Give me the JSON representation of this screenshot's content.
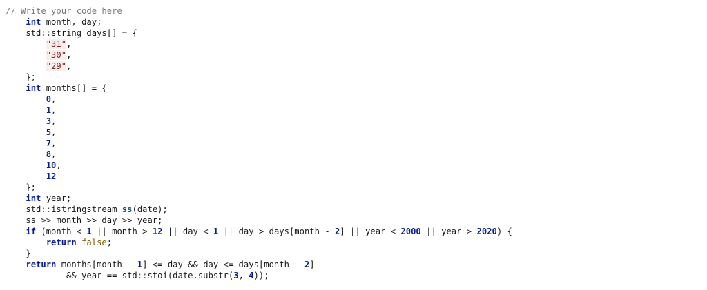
{
  "editor": {
    "lines": [
      [
        [
          "comment",
          "// Write your code here"
        ]
      ],
      [
        [
          "plain",
          "    "
        ],
        [
          "kw",
          "int"
        ],
        [
          "plain",
          " month, day;"
        ]
      ],
      [
        [
          "plain",
          "    std"
        ],
        [
          "op",
          "::"
        ],
        [
          "plain",
          "string days[] = {"
        ]
      ],
      [
        [
          "plain",
          "        "
        ],
        [
          "str",
          "\"31\""
        ],
        [
          "plain",
          ","
        ]
      ],
      [
        [
          "plain",
          "        "
        ],
        [
          "str",
          "\"30\""
        ],
        [
          "plain",
          ","
        ]
      ],
      [
        [
          "plain",
          "        "
        ],
        [
          "str",
          "\"29\""
        ],
        [
          "plain",
          ","
        ]
      ],
      [
        [
          "plain",
          "    };"
        ]
      ],
      [
        [
          "plain",
          "    "
        ],
        [
          "kw",
          "int"
        ],
        [
          "plain",
          " months[] = {"
        ]
      ],
      [
        [
          "plain",
          "        "
        ],
        [
          "num",
          "0"
        ],
        [
          "plain",
          ","
        ]
      ],
      [
        [
          "plain",
          "        "
        ],
        [
          "num",
          "1"
        ],
        [
          "plain",
          ","
        ]
      ],
      [
        [
          "plain",
          "        "
        ],
        [
          "num",
          "3"
        ],
        [
          "plain",
          ","
        ]
      ],
      [
        [
          "plain",
          "        "
        ],
        [
          "num",
          "5"
        ],
        [
          "plain",
          ","
        ]
      ],
      [
        [
          "plain",
          "        "
        ],
        [
          "num",
          "7"
        ],
        [
          "plain",
          ","
        ]
      ],
      [
        [
          "plain",
          "        "
        ],
        [
          "num",
          "8"
        ],
        [
          "plain",
          ","
        ]
      ],
      [
        [
          "plain",
          "        "
        ],
        [
          "num",
          "10"
        ],
        [
          "plain",
          ","
        ]
      ],
      [
        [
          "plain",
          "        "
        ],
        [
          "num",
          "12"
        ]
      ],
      [
        [
          "plain",
          "    };"
        ]
      ],
      [
        [
          "plain",
          "    "
        ],
        [
          "kw",
          "int"
        ],
        [
          "plain",
          " year;"
        ]
      ],
      [
        [
          "plain",
          "    std"
        ],
        [
          "op",
          "::"
        ],
        [
          "plain",
          "istringstream "
        ],
        [
          "fn",
          "ss"
        ],
        [
          "plain",
          "(date);"
        ]
      ],
      [
        [
          "plain",
          "    ss >> month >> day >> year;"
        ]
      ],
      [
        [
          "plain",
          "    "
        ],
        [
          "kw",
          "if"
        ],
        [
          "plain",
          " (month < "
        ],
        [
          "num",
          "1"
        ],
        [
          "plain",
          " || month > "
        ],
        [
          "num",
          "12"
        ],
        [
          "plain",
          " || day < "
        ],
        [
          "num",
          "1"
        ],
        [
          "plain",
          " || day > days[month - "
        ],
        [
          "num",
          "2"
        ],
        [
          "plain",
          "] || year < "
        ],
        [
          "num",
          "2000"
        ],
        [
          "plain",
          " || year > "
        ],
        [
          "num",
          "2020"
        ],
        [
          "plain",
          ") {"
        ]
      ],
      [
        [
          "plain",
          "        "
        ],
        [
          "kw",
          "return"
        ],
        [
          "plain",
          " "
        ],
        [
          "bool",
          "false"
        ],
        [
          "plain",
          ";"
        ]
      ],
      [
        [
          "plain",
          "    }"
        ]
      ],
      [
        [
          "plain",
          "    "
        ],
        [
          "kw",
          "return"
        ],
        [
          "plain",
          " months[month - "
        ],
        [
          "num",
          "1"
        ],
        [
          "plain",
          "] <= day && day <= days[month - "
        ],
        [
          "num",
          "2"
        ],
        [
          "plain",
          "]"
        ]
      ],
      [
        [
          "plain",
          "            && year == std"
        ],
        [
          "op",
          "::"
        ],
        [
          "plain",
          "stoi(date.substr("
        ],
        [
          "num",
          "3"
        ],
        [
          "plain",
          ", "
        ],
        [
          "num",
          "4"
        ],
        [
          "plain",
          "));"
        ]
      ]
    ]
  },
  "colors": {
    "background": "#ffffff",
    "keyword": "#0b1f8c",
    "comment": "#7a7a7a",
    "string": "#8a2a2a"
  }
}
